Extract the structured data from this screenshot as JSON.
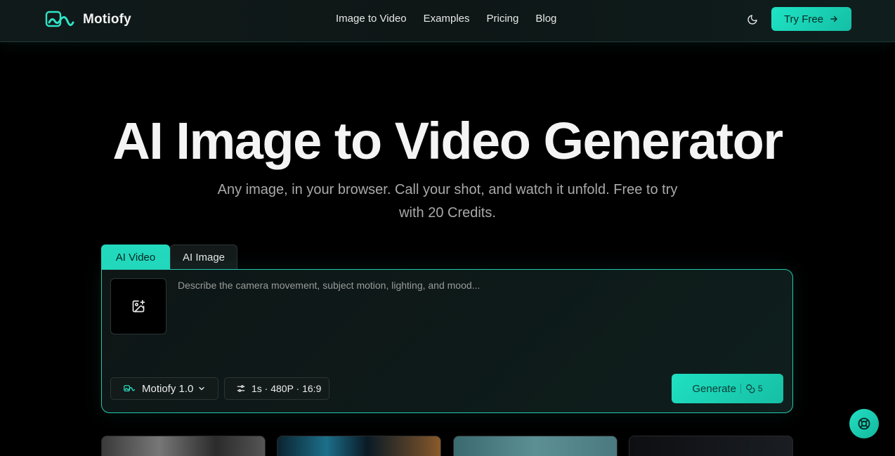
{
  "brand": {
    "name": "Motiofy"
  },
  "nav": {
    "links": [
      "Image to Video",
      "Examples",
      "Pricing",
      "Blog"
    ],
    "try_label": "Try Free"
  },
  "hero": {
    "title": "AI Image to Video Generator",
    "subtitle": "Any image, in your browser. Call your shot, and watch it unfold. Free to try with 20 Credits."
  },
  "tabs": [
    {
      "label": "AI Video",
      "active": true
    },
    {
      "label": "AI Image",
      "active": false
    }
  ],
  "editor": {
    "prompt_placeholder": "Describe the camera movement, subject motion, lighting, and mood...",
    "model_label": "Motiofy 1.0",
    "settings_label": "1s · 480P · 16:9",
    "generate_label": "Generate",
    "generate_cost": "5"
  },
  "colors": {
    "accent": "#23d9bd",
    "background": "#000000"
  },
  "icons": {
    "logo": "wave-logo-icon",
    "theme": "moon-icon",
    "try_arrow": "arrow-right-icon",
    "upload": "image-plus-icon",
    "model": "wave-logo-icon",
    "model_dropdown": "chevron-down-icon",
    "settings": "sliders-icon",
    "cost": "coins-icon",
    "help": "lifebuoy-icon"
  }
}
